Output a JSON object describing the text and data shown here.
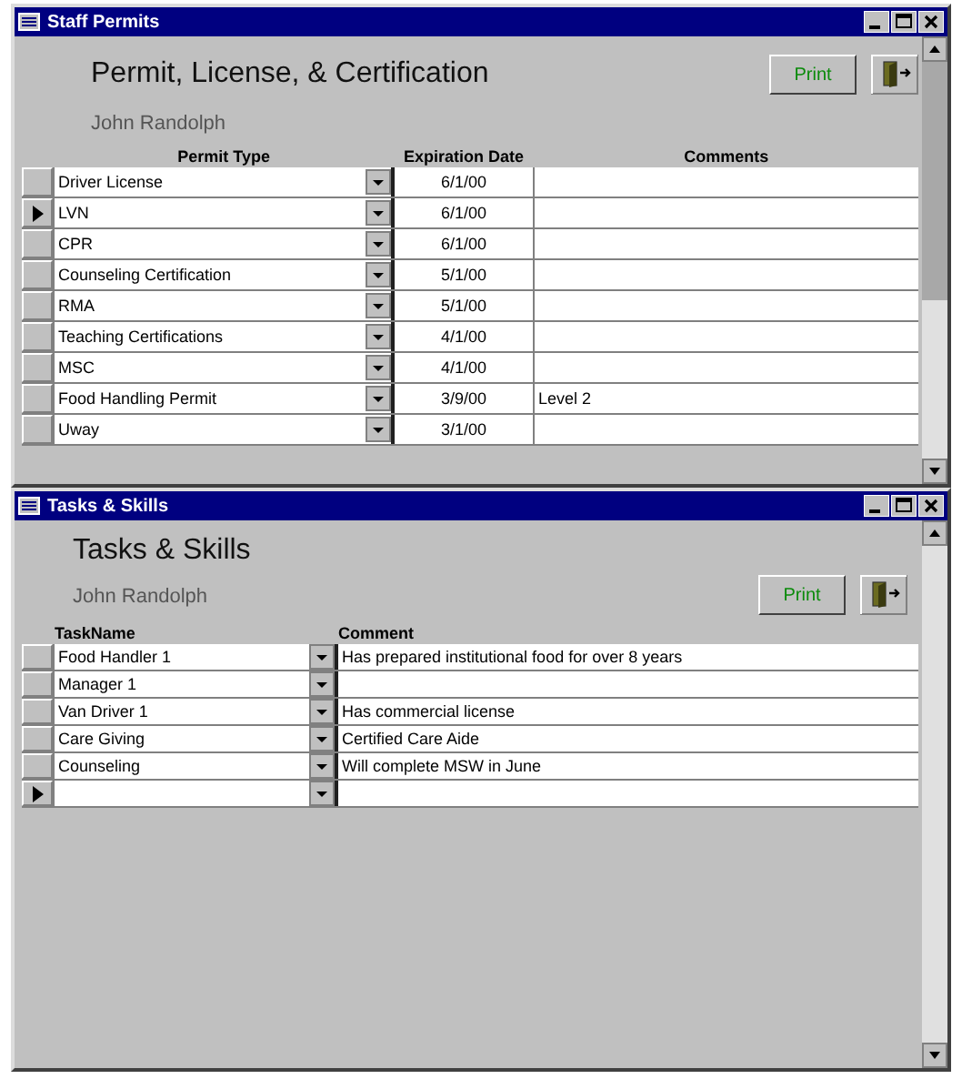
{
  "windows": [
    {
      "title": "Staff Permits",
      "heading": "Permit, License, & Certification",
      "person": "John Randolph",
      "print_button": "Print",
      "columns": [
        "Permit Type",
        "Expiration Date",
        "Comments"
      ],
      "kind": "permits",
      "rows": [
        {
          "cells": [
            "Driver License",
            "6/1/00",
            ""
          ],
          "current": false
        },
        {
          "cells": [
            "LVN",
            "6/1/00",
            ""
          ],
          "current": true
        },
        {
          "cells": [
            "CPR",
            "6/1/00",
            ""
          ],
          "current": false
        },
        {
          "cells": [
            "Counseling Certification",
            "5/1/00",
            ""
          ],
          "current": false
        },
        {
          "cells": [
            "RMA",
            "5/1/00",
            ""
          ],
          "current": false
        },
        {
          "cells": [
            "Teaching Certifications",
            "4/1/00",
            ""
          ],
          "current": false
        },
        {
          "cells": [
            "MSC",
            "4/1/00",
            ""
          ],
          "current": false
        },
        {
          "cells": [
            "Food Handling Permit",
            "3/9/00",
            "Level 2"
          ],
          "current": false
        },
        {
          "cells": [
            "Uway",
            "3/1/00",
            ""
          ],
          "current": false
        }
      ]
    },
    {
      "title": "Tasks & Skills",
      "heading": "Tasks & Skills",
      "person": "John Randolph",
      "print_button": "Print",
      "columns": [
        "TaskName",
        "Comment"
      ],
      "kind": "tasks",
      "rows": [
        {
          "cells": [
            "Food Handler 1",
            "Has prepared institutional food for over 8 years"
          ],
          "current": false
        },
        {
          "cells": [
            "Manager 1",
            ""
          ],
          "current": false
        },
        {
          "cells": [
            "Van Driver 1",
            "Has commercial license"
          ],
          "current": false
        },
        {
          "cells": [
            "Care Giving",
            "Certified Care Aide"
          ],
          "current": false
        },
        {
          "cells": [
            "Counseling",
            "Will complete MSW in June"
          ],
          "current": false
        },
        {
          "cells": [
            "",
            ""
          ],
          "current": true
        }
      ]
    }
  ]
}
